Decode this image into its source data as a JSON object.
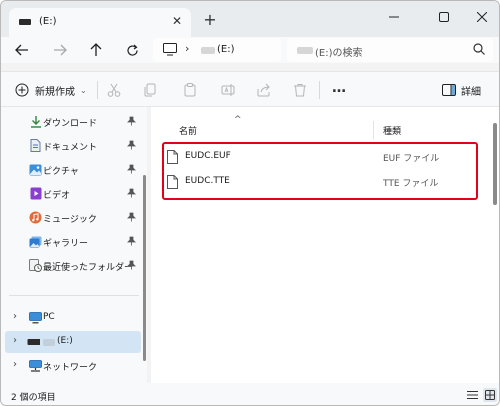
{
  "tab": {
    "label": "(E:)",
    "close_glyph": "✕",
    "new_tab_glyph": "+"
  },
  "address": {
    "chevron": "›",
    "label": "(E:)"
  },
  "search": {
    "placeholder": "(E:)の検索"
  },
  "toolbar": {
    "new_label": "新規作成",
    "new_caret": "⌄",
    "more_label": "…",
    "details_label": "詳細"
  },
  "sidebar": {
    "items": [
      {
        "label": "ダウンロード",
        "icon": "download-icon",
        "pinned": true
      },
      {
        "label": "ドキュメント",
        "icon": "document-icon",
        "pinned": true
      },
      {
        "label": "ピクチャ",
        "icon": "pictures-icon",
        "pinned": true
      },
      {
        "label": "ビデオ",
        "icon": "video-icon",
        "pinned": true
      },
      {
        "label": "ミュージック",
        "icon": "music-icon",
        "pinned": true
      },
      {
        "label": "ギャラリー",
        "icon": "gallery-icon",
        "pinned": true
      },
      {
        "label": "最近使ったフォルダー",
        "icon": "recent-folder-icon",
        "pinned": true
      }
    ],
    "drives": [
      {
        "label": "PC",
        "icon": "pc-icon",
        "chevron": "›",
        "selected": false
      },
      {
        "label": "(E:)",
        "icon": "drive-icon",
        "chevron": "›",
        "selected": true
      },
      {
        "label": "ネットワーク",
        "icon": "network-icon",
        "chevron": "›",
        "selected": false
      }
    ]
  },
  "file_list": {
    "headers": {
      "name": "名前",
      "type": "種類"
    },
    "sort_caret": "^",
    "rows": [
      {
        "name": "EUDC.EUF",
        "type": "EUF ファイル"
      },
      {
        "name": "EUDC.TTE",
        "type": "TTE ファイル"
      }
    ]
  },
  "status": {
    "count": "2 個の項目"
  },
  "colors": {
    "highlight": "#e3001b",
    "selected": "#d3e5f5",
    "accent": "#0067c0"
  }
}
